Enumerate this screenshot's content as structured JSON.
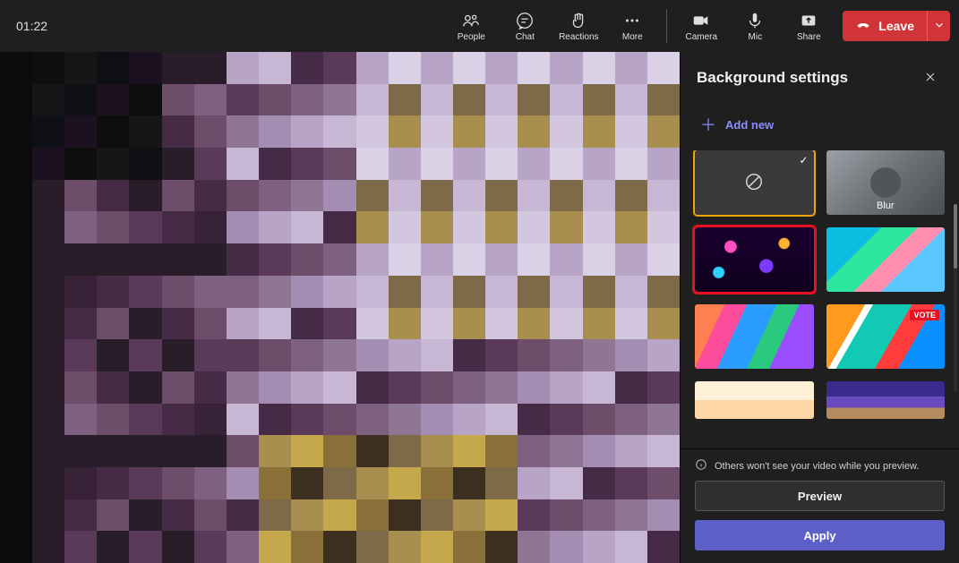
{
  "meeting": {
    "elapsed": "01:22"
  },
  "toolbar": {
    "people": "People",
    "chat": "Chat",
    "reactions": "Reactions",
    "more": "More",
    "camera": "Camera",
    "mic": "Mic",
    "share": "Share",
    "leave": "Leave"
  },
  "panel": {
    "title": "Background settings",
    "add_new": "Add new",
    "options": {
      "none": {
        "label": "",
        "selected": true
      },
      "blur": {
        "label": "Blur"
      },
      "abs1": {
        "label": "",
        "highlighted": true
      },
      "abs2": {
        "label": ""
      },
      "abs3": {
        "label": ""
      },
      "abs4": {
        "label": "",
        "tag": "VOTE"
      },
      "abs5": {
        "label": ""
      },
      "abs6": {
        "label": ""
      }
    },
    "note": "Others won't see your video while you preview.",
    "preview": "Preview",
    "apply": "Apply"
  },
  "mosaic_palette": [
    "#0e0e0e",
    "#161616",
    "#0f0f16",
    "#1b1120",
    "#2a1d2a",
    "#372237",
    "#462b47",
    "#5a3a58",
    "#6d4d6a",
    "#7e6080",
    "#907695",
    "#a38db2",
    "#b7a4c6",
    "#c7b7d5",
    "#d3c6df",
    "#dbd1e6",
    "#7e6a49",
    "#a88f4f",
    "#c5a84b",
    "#8a7038",
    "#3c2f1f",
    "#241b13",
    "#141418",
    "#20304a",
    "#303f57",
    "#1e2538",
    "#141e2e",
    "#0d141f",
    "#121017",
    "#321826",
    "#231521",
    "#101018",
    "#baacc8",
    "#e6def0",
    "#fafafa",
    "#e8e8e8"
  ]
}
